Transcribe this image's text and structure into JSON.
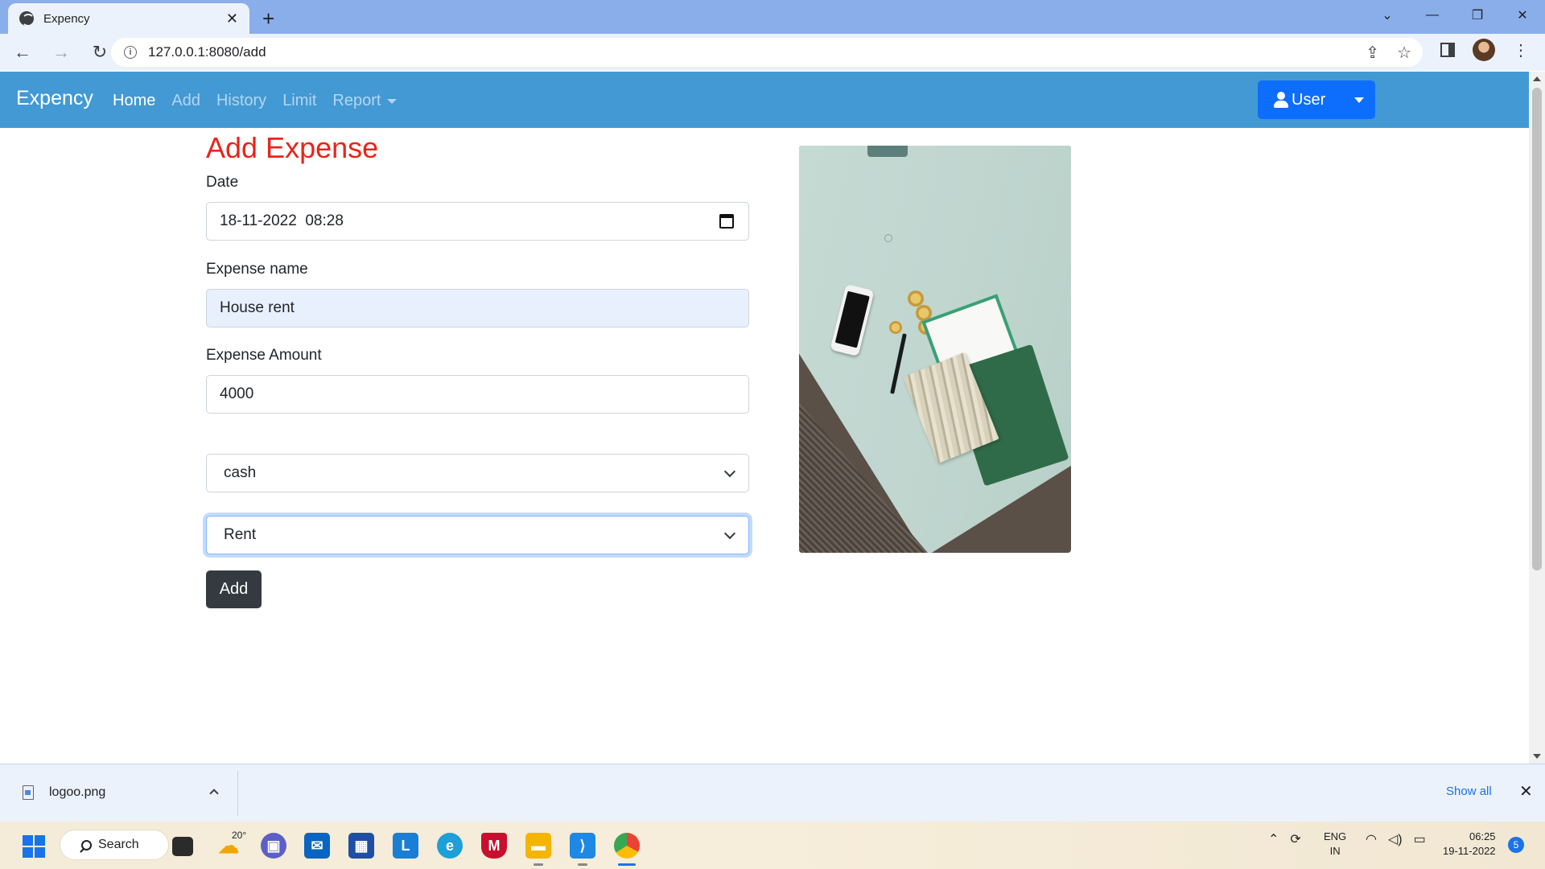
{
  "browser": {
    "tab_title": "Expency",
    "url": "127.0.0.1:8080/add"
  },
  "navbar": {
    "brand": "Expency",
    "links": [
      {
        "label": "Home",
        "active": true
      },
      {
        "label": "Add",
        "active": false
      },
      {
        "label": "History",
        "active": false
      },
      {
        "label": "Limit",
        "active": false
      },
      {
        "label": "Report",
        "active": false
      }
    ],
    "user_button": "User"
  },
  "form": {
    "title": "Add Expense",
    "date_label": "Date",
    "date_value": "18-11-2022  08:28",
    "name_label": "Expense name",
    "name_value": "House rent",
    "amount_label": "Expense Amount",
    "amount_value": "4000",
    "payment_selected": "cash",
    "category_selected": "Rent",
    "submit_label": "Add"
  },
  "download_shelf": {
    "file_name": "logoo.png",
    "show_all": "Show all"
  },
  "taskbar": {
    "search_label": "Search",
    "weather_temp": "20°",
    "lang_line1": "ENG",
    "lang_line2": "IN",
    "time": "06:25",
    "date": "19-11-2022",
    "notification_count": "5"
  },
  "colors": {
    "navbar_bg": "#4299d4",
    "title_red": "#e8241b",
    "user_button_bg": "#0d6efd",
    "add_button_bg": "#343a40"
  }
}
